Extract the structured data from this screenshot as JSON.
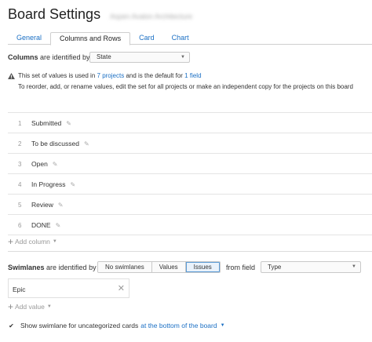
{
  "header": {
    "title": "Board Settings",
    "board_name": "Aspen Avalon Architecture"
  },
  "tabs": [
    {
      "label": "General",
      "active": false
    },
    {
      "label": "Columns and Rows",
      "active": true
    },
    {
      "label": "Card",
      "active": false
    },
    {
      "label": "Chart",
      "active": false
    }
  ],
  "columns_section": {
    "label_bold": "Columns",
    "label_rest": " are identified by",
    "field_select": "State"
  },
  "warning": {
    "line1_prefix": "This set of values is used in",
    "projects_link": "7 projects",
    "line1_middle": "and is the default for",
    "field_link": "1 field",
    "line2": "To reorder, add, or rename values, edit the set for all projects or make an independent copy for the projects on this board"
  },
  "columns": [
    {
      "num": "1",
      "name": "Submitted"
    },
    {
      "num": "2",
      "name": "To be discussed"
    },
    {
      "num": "3",
      "name": "Open"
    },
    {
      "num": "4",
      "name": "In Progress"
    },
    {
      "num": "5",
      "name": "Review"
    },
    {
      "num": "6",
      "name": "DONE"
    }
  ],
  "add_column_label": "Add column",
  "swimlanes": {
    "label_bold": "Swimlanes",
    "label_rest": " are identified by",
    "options": [
      "No swimlanes",
      "Values",
      "Issues"
    ],
    "active_option": "Issues",
    "from_field_label": "from field",
    "field_select": "Type",
    "values": [
      "Epic"
    ],
    "add_value_label": "Add value"
  },
  "uncategorized": {
    "checked": true,
    "label": "Show swimlane for uncategorized cards",
    "position_link": "at the bottom of the board"
  },
  "colors": {
    "link": "#1a6fc4",
    "active_segment_border": "#5b9bd5",
    "warning_icon": "#555555"
  }
}
